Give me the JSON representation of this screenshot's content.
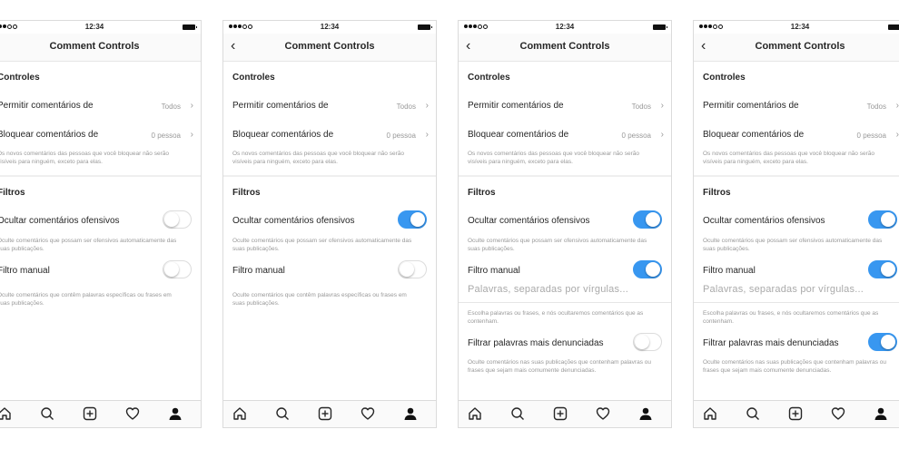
{
  "status": {
    "time": "12:34"
  },
  "screen": {
    "title": "Comment Controls",
    "controls_header": "Controles",
    "allow_label": "Permitir comentários de",
    "allow_value": "Todos",
    "block_label": "Bloquear comentários de",
    "block_value": "0 pessoa",
    "block_help": "Os novos comentários das pessoas que você bloquear não serão visíveis para ninguém, exceto para elas.",
    "filters_header": "Filtros",
    "offensive_label": "Ocultar comentários ofensivos",
    "offensive_help": "Oculte comentários que possam ser ofensivos automaticamente das suas publicações.",
    "manual_label": "Filtro manual",
    "manual_help_off": "Oculte comentários que contêm palavras específicas ou frases em suas publicações.",
    "keywords_placeholder": "Palavras, separadas por vírgulas...",
    "keywords_help": "Escolha palavras ou frases, e nós ocultaremos comentários que as contenham.",
    "reported_label": "Filtrar palavras mais denunciadas",
    "reported_help": "Oculte comentários nas suas publicações que contenham palavras ou frases que sejam mais comumente denunciadas."
  },
  "phones": [
    {
      "offensive": "off",
      "manual": "off",
      "reported": null
    },
    {
      "offensive": "on",
      "manual": "off",
      "reported": null
    },
    {
      "offensive": "on",
      "manual": "on",
      "reported": "off"
    },
    {
      "offensive": "on",
      "manual": "on",
      "reported": "on"
    }
  ],
  "tabbar": [
    "home-icon",
    "search-icon",
    "add-post-icon",
    "activity-heart-icon",
    "profile-icon"
  ],
  "colors": {
    "toggle_on": "#3897f0",
    "toggle_off": "#ffffff",
    "hint": "#999999"
  }
}
